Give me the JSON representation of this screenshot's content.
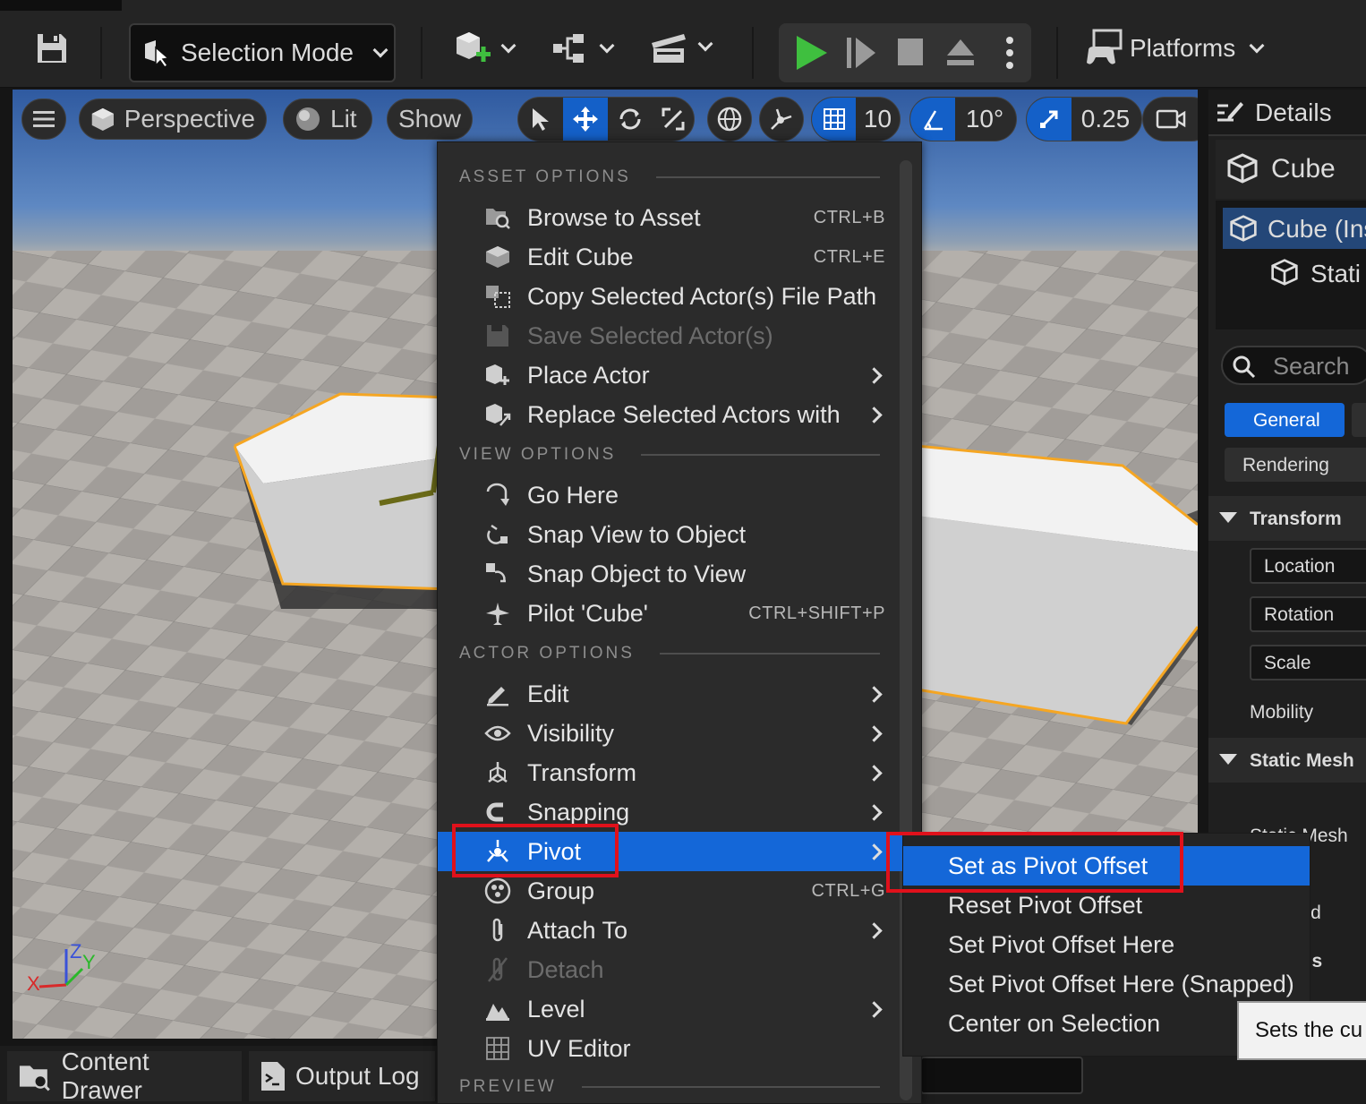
{
  "toolbar": {
    "mode_label": "Selection Mode",
    "platforms_label": "Platforms",
    "icons": [
      "save-icon",
      "selection-mode-icon",
      "add-actor-icon",
      "blueprint-icon",
      "cinematics-icon",
      "play-icon",
      "advance-frame-icon",
      "stop-icon",
      "eject-icon",
      "more-options-icon",
      "platforms-icon"
    ]
  },
  "viewport": {
    "menu_icon": "hamburger-icon",
    "perspective_label": "Perspective",
    "lit_label": "Lit",
    "show_label": "Show",
    "grid_snap_value": "10",
    "rotation_snap_value": "10°",
    "scale_snap_value": "0.25",
    "axis": {
      "x": "X",
      "y": "Y",
      "z": "Z"
    }
  },
  "details": {
    "title": "Details",
    "actor_name": "Cube",
    "tree_root": "Cube (Ins",
    "tree_child": "Stati",
    "search_placeholder": "Search",
    "tabs": [
      "General",
      "Rendering"
    ],
    "transform_header": "Transform",
    "transform_rows": [
      "Location",
      "Rotation",
      "Scale"
    ],
    "mobility_label": "Mobility",
    "static_mesh_header": "Static Mesh",
    "static_mesh_row": "Static Mesh",
    "partial_1": "ced",
    "partial_2": "als"
  },
  "bottom": {
    "content_drawer": "Content Drawer",
    "output_log": "Output Log"
  },
  "context_menu": {
    "sections": {
      "asset": "ASSET OPTIONS",
      "view": "VIEW OPTIONS",
      "actor": "ACTOR OPTIONS",
      "preview": "PREVIEW"
    },
    "items": [
      {
        "label": "Browse to Asset",
        "shortcut": "CTRL+B",
        "icon": "browse-folder-icon"
      },
      {
        "label": "Edit Cube",
        "shortcut": "CTRL+E",
        "icon": "edit-asset-icon"
      },
      {
        "label": "Copy Selected Actor(s) File Path",
        "shortcut": "",
        "icon": "copy-path-icon"
      },
      {
        "label": "Save Selected Actor(s)",
        "shortcut": "",
        "icon": "save-icon",
        "disabled": true
      },
      {
        "label": "Place Actor",
        "shortcut": "",
        "icon": "place-actor-icon",
        "submenu": true
      },
      {
        "label": "Replace Selected Actors with",
        "shortcut": "",
        "icon": "replace-actor-icon",
        "submenu": true
      },
      {
        "label": "Go Here",
        "shortcut": "",
        "icon": "go-here-icon"
      },
      {
        "label": "Snap View to Object",
        "shortcut": "",
        "icon": "snap-view-icon"
      },
      {
        "label": "Snap Object to View",
        "shortcut": "",
        "icon": "snap-object-icon"
      },
      {
        "label": "Pilot 'Cube'",
        "shortcut": "CTRL+SHIFT+P",
        "icon": "pilot-icon"
      },
      {
        "label": "Edit",
        "shortcut": "",
        "icon": "pencil-icon",
        "submenu": true
      },
      {
        "label": "Visibility",
        "shortcut": "",
        "icon": "eye-icon",
        "submenu": true
      },
      {
        "label": "Transform",
        "shortcut": "",
        "icon": "transform-icon",
        "submenu": true
      },
      {
        "label": "Snapping",
        "shortcut": "",
        "icon": "magnet-icon",
        "submenu": true
      },
      {
        "label": "Pivot",
        "shortcut": "",
        "icon": "pivot-icon",
        "submenu": true,
        "selected": true
      },
      {
        "label": "Group",
        "shortcut": "CTRL+G",
        "icon": "group-icon"
      },
      {
        "label": "Attach To",
        "shortcut": "",
        "icon": "attach-icon",
        "submenu": true
      },
      {
        "label": "Detach",
        "shortcut": "",
        "icon": "detach-icon",
        "disabled": true
      },
      {
        "label": "Level",
        "shortcut": "",
        "icon": "level-icon",
        "submenu": true
      },
      {
        "label": "UV Editor",
        "shortcut": "",
        "icon": "uv-grid-icon"
      }
    ]
  },
  "pivot_submenu": {
    "items": [
      {
        "label": "Set as Pivot Offset",
        "selected": true
      },
      {
        "label": "Reset Pivot Offset"
      },
      {
        "label": "Set Pivot Offset Here"
      },
      {
        "label": "Set Pivot Offset Here (Snapped)"
      },
      {
        "label": "Center on Selection"
      }
    ]
  },
  "tooltip": {
    "text": "Sets the cu"
  },
  "colors": {
    "accent": "#1467d8",
    "highlight_box": "#e0111b",
    "selection_outline": "#f5a623",
    "play_green": "#3fbf3f"
  }
}
